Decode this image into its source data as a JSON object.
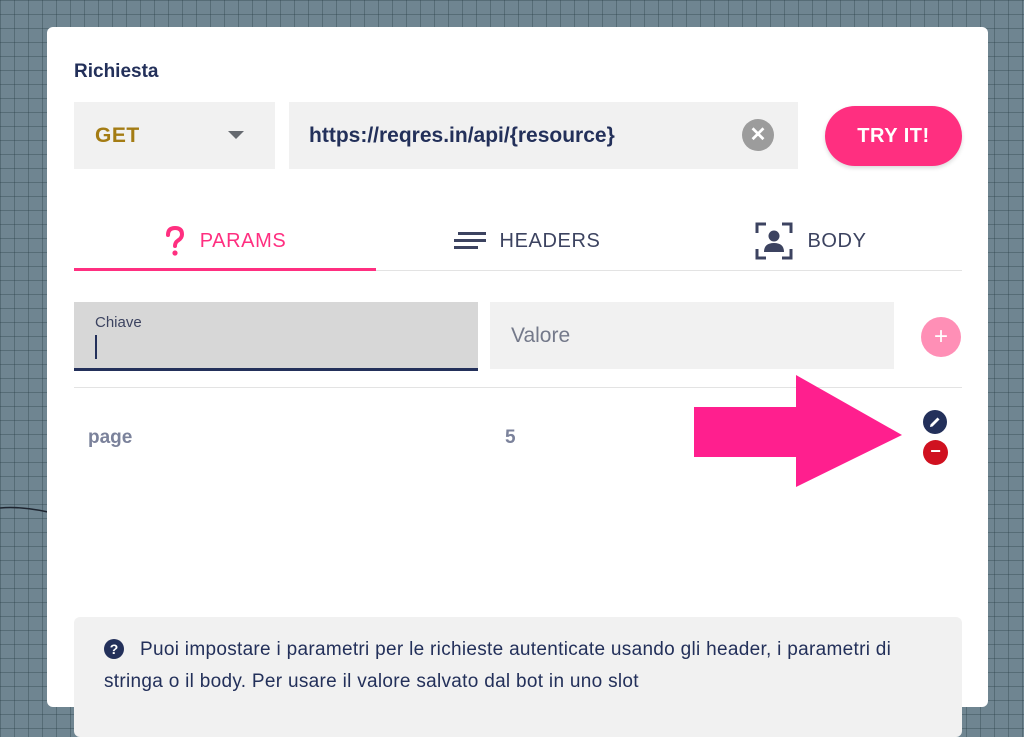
{
  "request": {
    "section_title": "Richiesta",
    "method": "GET",
    "url": "https://reqres.in/api/{resource}",
    "try_label": "TRY IT!"
  },
  "tabs": [
    {
      "label": "PARAMS",
      "icon": "question-icon",
      "active": true
    },
    {
      "label": "HEADERS",
      "icon": "lines-icon",
      "active": false
    },
    {
      "label": "BODY",
      "icon": "face-scan-icon",
      "active": false
    }
  ],
  "param_form": {
    "key_label": "Chiave",
    "key_value": "",
    "value_placeholder": "Valore",
    "add_icon": "+"
  },
  "params": [
    {
      "key": "page",
      "value": "5"
    }
  ],
  "info": {
    "text": "Puoi impostare i parametri per le richieste autenticate usando gli header, i parametri di stringa o il body. Per usare il valore salvato dal bot in uno slot"
  },
  "colors": {
    "accent": "#ff2f80",
    "navy": "#23305a",
    "method": "#a47c14",
    "danger": "#d01120",
    "background": "#6f8591"
  }
}
